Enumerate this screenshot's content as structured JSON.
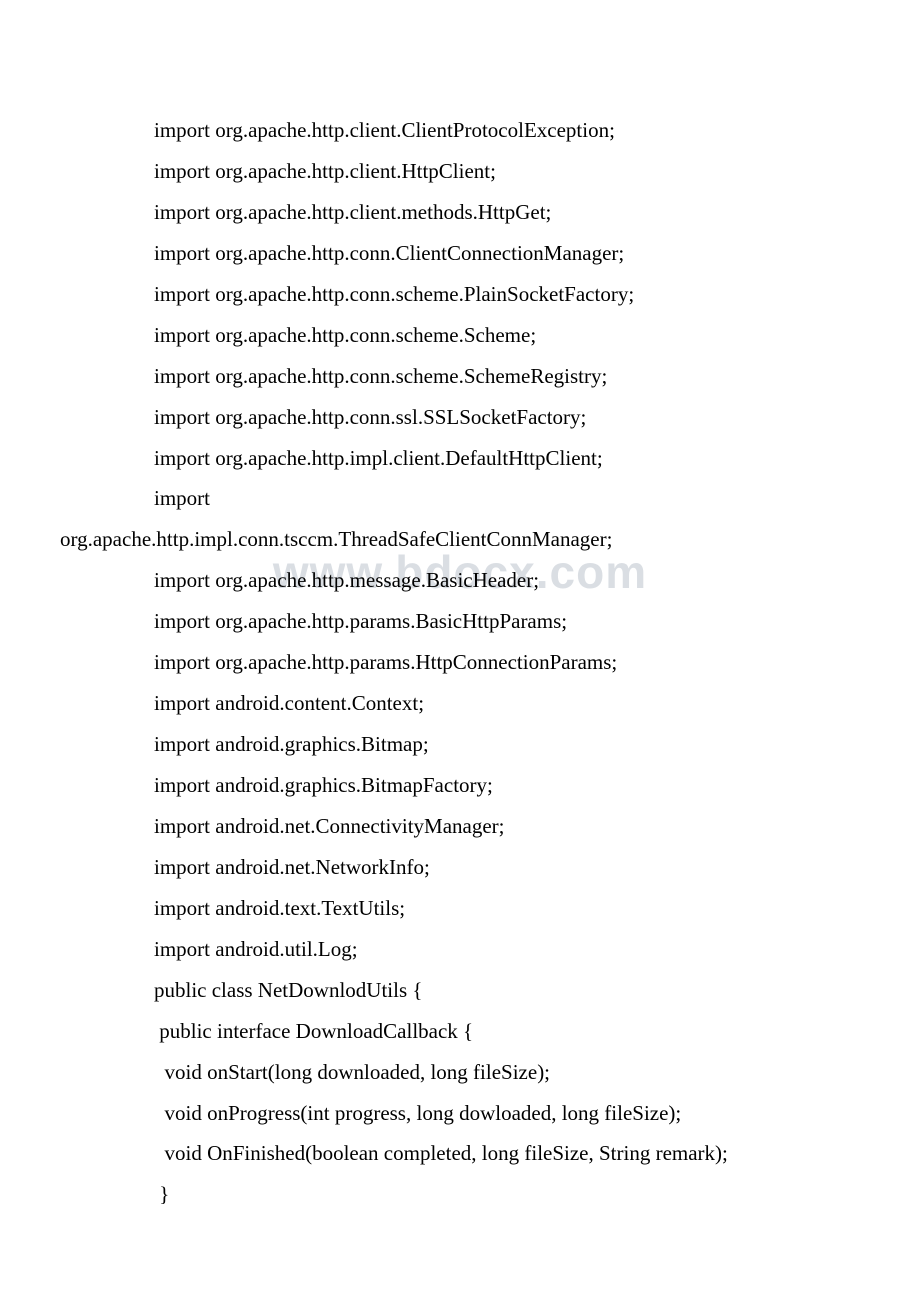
{
  "watermark": "www.bdocx.com",
  "lines": [
    {
      "text": "import org.apache.http.client.ClientProtocolException;",
      "indent": true
    },
    {
      "text": "import org.apache.http.client.HttpClient;",
      "indent": true
    },
    {
      "text": "import org.apache.http.client.methods.HttpGet;",
      "indent": true
    },
    {
      "text": "import org.apache.http.conn.ClientConnectionManager;",
      "indent": true
    },
    {
      "text": "import org.apache.http.conn.scheme.PlainSocketFactory;",
      "indent": true
    },
    {
      "text": "import org.apache.http.conn.scheme.Scheme;",
      "indent": true
    },
    {
      "text": "import org.apache.http.conn.scheme.SchemeRegistry;",
      "indent": true
    },
    {
      "text": "import org.apache.http.conn.ssl.SSLSocketFactory;",
      "indent": true
    },
    {
      "text": "import org.apache.http.impl.client.DefaultHttpClient;",
      "indent": true
    },
    {
      "text": "import",
      "indent": true
    },
    {
      "text": "org.apache.http.impl.conn.tsccm.ThreadSafeClientConnManager;",
      "indent": false
    },
    {
      "text": "import org.apache.http.message.BasicHeader;",
      "indent": true
    },
    {
      "text": "import org.apache.http.params.BasicHttpParams;",
      "indent": true
    },
    {
      "text": "import org.apache.http.params.HttpConnectionParams;",
      "indent": true
    },
    {
      "text": "import android.content.Context;",
      "indent": true
    },
    {
      "text": "import android.graphics.Bitmap;",
      "indent": true
    },
    {
      "text": "import android.graphics.BitmapFactory;",
      "indent": true
    },
    {
      "text": "import android.net.ConnectivityManager;",
      "indent": true
    },
    {
      "text": "import android.net.NetworkInfo;",
      "indent": true
    },
    {
      "text": "import android.text.TextUtils;",
      "indent": true
    },
    {
      "text": "import android.util.Log;",
      "indent": true
    },
    {
      "text": "public class NetDownlodUtils {",
      "indent": true
    },
    {
      "text": " public interface DownloadCallback {",
      "indent": true
    },
    {
      "text": "  void onStart(long downloaded, long fileSize);",
      "indent": true
    },
    {
      "text": "  void onProgress(int progress, long dowloaded, long fileSize);",
      "indent": true
    },
    {
      "text": "  void OnFinished(boolean completed, long fileSize, String remark);",
      "indent": true
    },
    {
      "text": " }",
      "indent": true
    }
  ]
}
